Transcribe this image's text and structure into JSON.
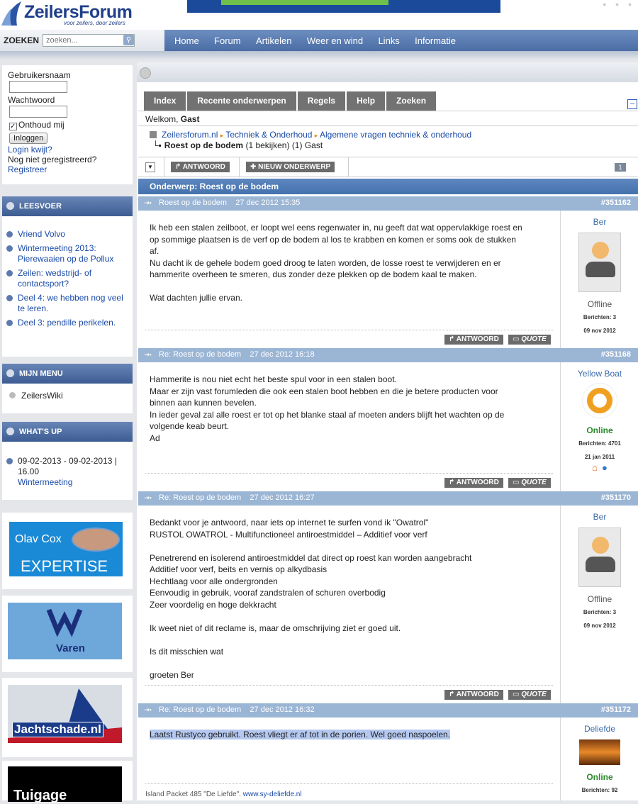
{
  "header": {
    "logo_name": "ZeilersForum",
    "logo_slogan": "voor zeilers, door zeilers"
  },
  "search": {
    "label": "ZOEKEN",
    "placeholder": "zoeken..."
  },
  "nav": [
    "Home",
    "Forum",
    "Artikelen",
    "Weer en wind",
    "Links",
    "Informatie"
  ],
  "login": {
    "username_label": "Gebruikersnaam",
    "password_label": "Wachtwoord",
    "remember_label": "Onthoud mij",
    "login_button": "Inloggen",
    "forgot_link": "Login kwijt?",
    "not_registered": "Nog niet geregistreerd?",
    "register_link": "Registreer"
  },
  "leesvoer": {
    "title": "LEESVOER",
    "items": [
      "Vriend Volvo",
      "Wintermeeting 2013: Pierewaaien op de Pollux",
      "Zeilen: wedstrijd- of contactsport?",
      "Deel 4: we hebben nog veel te leren.",
      "Deel 3: pendille perikelen."
    ]
  },
  "mijnmenu": {
    "title": "MIJN MENU",
    "item": "ZeilersWiki"
  },
  "whatsup": {
    "title": "WHAT'S UP",
    "date": "09-02-2013 - 09-02-2013 | 16.00",
    "event": "Wintermeeting"
  },
  "ads": {
    "olav_name": "Olav Cox",
    "olav_sub": "EXPERTISE",
    "varen": "Varen",
    "jachtschade": "Jachtschade.nl",
    "tuigage": "Tuigage"
  },
  "tabs": [
    "Index",
    "Recente onderwerpen",
    "Regels",
    "Help",
    "Zoeken"
  ],
  "welcome": {
    "prefix": "Welkom,",
    "user": "Gast"
  },
  "breadcrumb": {
    "site": "Zeilersforum.nl",
    "cat": "Techniek & Onderhoud",
    "sub": "Algemene vragen techniek & onderhoud",
    "topic": "Roest op de bodem",
    "viewers": "(1 bekijken) (1) Gast"
  },
  "toolbar": {
    "reply": "ANTWOORD",
    "new_topic": "NIEUW ONDERWERP",
    "page": "1"
  },
  "topic_title": "Onderwerp: Roest op de bodem",
  "post_buttons": {
    "reply": "ANTWOORD",
    "quote": "QUOTE"
  },
  "posts": [
    {
      "title": "Roest op de bodem",
      "date": "27 dec 2012 15:35",
      "id": "#351162",
      "body": "Ik heb een stalen zeilboot, er loopt wel eens regenwater in, nu geeft dat wat oppervlakkige roest en\nop sommige plaatsen is de verf op de bodem al los te krabben en komen er soms ook de stukken\naf.\nNu dacht ik de gehele bodem goed droog te laten worden, de losse roest te verwijderen en er\nhammerite overheen te smeren, dus zonder deze plekken op de bodem kaal te maken.\n\nWat dachten jullie ervan.",
      "user": "Ber",
      "status": "Offline",
      "posts_count": "Berichten: 3",
      "joined": "09 nov 2012"
    },
    {
      "title": "Re: Roest op de bodem",
      "date": "27 dec 2012 16:18",
      "id": "#351168",
      "body": "Hammerite is nou niet echt het beste spul voor in een stalen boot.\nMaar er zijn vast forumleden die ook een stalen boot hebben en die je betere producten voor\nbinnen aan kunnen bevelen.\nIn ieder geval zal alle roest er tot op het blanke staal af moeten anders blijft het wachten op de\nvolgende keab beurt.\nAd",
      "user": "Yellow Boat",
      "status": "Online",
      "posts_count": "Berichten: 4701",
      "joined": "21 jan 2011"
    },
    {
      "title": "Re: Roest op de bodem",
      "date": "27 dec 2012 16:27",
      "id": "#351170",
      "body": "Bedankt voor je antwoord, naar iets op internet te surfen vond ik \"Owatrol\"\nRUSTOL OWATROL - Multifunctioneel antiroestmiddel – Additief voor verf\n\nPenetrerend en isolerend antiroestmiddel dat direct op roest kan worden aangebracht\nAdditief voor verf, beits en vernis op alkydbasis\nHechtlaag voor alle ondergronden\nEenvoudig in gebruik, vooraf zandstralen of schuren overbodig\nZeer voordelig en hoge dekkracht\n\nIk weet niet of dit reclame is, maar de omschrijving ziet er goed uit.\n\nIs dit misschien wat\n\ngroeten Ber",
      "user": "Ber",
      "status": "Offline",
      "posts_count": "Berichten: 3",
      "joined": "09 nov 2012"
    },
    {
      "title": "Re: Roest op de bodem",
      "date": "27 dec 2012 16:32",
      "id": "#351172",
      "body": "Laatst Rustyco gebruikt. Roest vliegt er af tot in de porien. Wel goed naspoelen.",
      "signature_text": "Island Packet 485 \"De Liefde\".",
      "signature_link": "www.sy-deliefde.nl",
      "user": "Deliefde",
      "status": "Online",
      "posts_count": "Berichten: 92"
    }
  ]
}
